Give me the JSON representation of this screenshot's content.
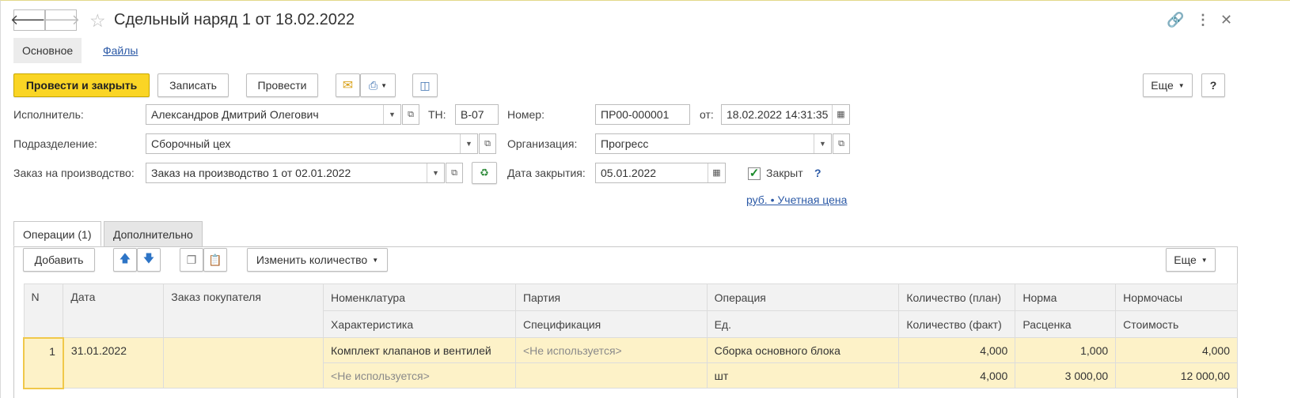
{
  "window": {
    "title": "Сдельный наряд 1 от 18.02.2022",
    "back_icon": "arrow-left-icon",
    "forward_icon": "arrow-right-icon",
    "favorite_icon": "star-icon",
    "link_icon": "link-icon",
    "more_icon": "vertical-dots-icon",
    "close_icon": "close-icon"
  },
  "tabs": {
    "main": "Основное",
    "files": "Файлы"
  },
  "toolbar": {
    "post_close": "Провести и закрыть",
    "save": "Записать",
    "post": "Провести",
    "more": "Еще",
    "help": "?"
  },
  "form": {
    "executor_label": "Исполнитель:",
    "executor_value": "Александров Дмитрий Олегович",
    "tn_label": "ТН:",
    "tn_value": "В-07",
    "number_label": "Номер:",
    "number_value": "ПР00-000001",
    "from_label": "от:",
    "from_value": "18.02.2022 14:31:35",
    "division_label": "Подразделение:",
    "division_value": "Сборочный цех",
    "org_label": "Организация:",
    "org_value": "Прогресс",
    "order_label": "Заказ на производство:",
    "order_value": "Заказ на производство 1 от 02.01.2022",
    "close_date_label": "Дата закрытия:",
    "close_date_value": "05.01.2022",
    "closed_label": "Закрыт",
    "closed_checked": true,
    "closed_help": "?",
    "price_link": "руб. • Учетная цена"
  },
  "panel_tabs": {
    "operations": "Операции (1)",
    "extra": "Дополнительно"
  },
  "panel_toolbar": {
    "add": "Добавить",
    "change_qty": "Изменить количество",
    "more": "Еще"
  },
  "table": {
    "header1": [
      "N",
      "Дата",
      "Заказ покупателя",
      "Номенклатура",
      "Партия",
      "Операция",
      "Количество (план)",
      "Норма",
      "Нормочасы"
    ],
    "header2": [
      "Характеристика",
      "Спецификация",
      "Ед.",
      "Количество (факт)",
      "Расценка",
      "Стоимость"
    ],
    "rows": [
      {
        "n": "1",
        "date": "31.01.2022",
        "customer_order": "",
        "nomenclature": "Комплект клапанов и вентилей",
        "batch": "<Не используется>",
        "operation": "Сборка основного блока",
        "qty_plan": "4,000",
        "norm": "1,000",
        "norm_hours": "4,000",
        "characteristic": "<Не используется>",
        "specification": "",
        "unit": "шт",
        "qty_fact": "4,000",
        "rate": "3 000,00",
        "cost": "12 000,00"
      }
    ]
  },
  "colors": {
    "primary_button": "#fad525",
    "link": "#2b59a6",
    "row_highlight": "#fdf2c8"
  }
}
